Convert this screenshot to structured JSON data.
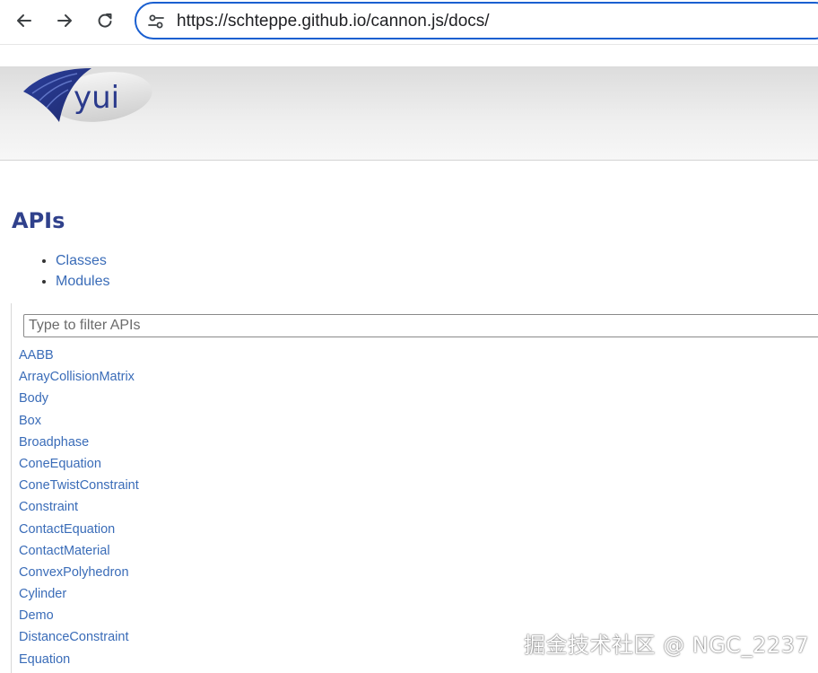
{
  "browser": {
    "url": "https://schteppe.github.io/cannon.js/docs/",
    "icons": {
      "back": "arrow-left-icon",
      "forward": "arrow-right-icon",
      "reload": "reload-icon",
      "site_info": "tune-icon"
    },
    "accent_color": "#1a5fd0"
  },
  "header": {
    "logo_text": "yui"
  },
  "content": {
    "title": "APIs",
    "top_links": [
      "Classes",
      "Modules"
    ],
    "filter_placeholder": "Type to filter APIs",
    "api_items": [
      "AABB",
      "ArrayCollisionMatrix",
      "Body",
      "Box",
      "Broadphase",
      "ConeEquation",
      "ConeTwistConstraint",
      "Constraint",
      "ContactEquation",
      "ContactMaterial",
      "ConvexPolyhedron",
      "Cylinder",
      "Demo",
      "DistanceConstraint",
      "Equation"
    ],
    "link_color": "#3a6cb8",
    "title_color": "#30418c"
  },
  "watermark": "掘金技术社区 @ NGC_2237"
}
